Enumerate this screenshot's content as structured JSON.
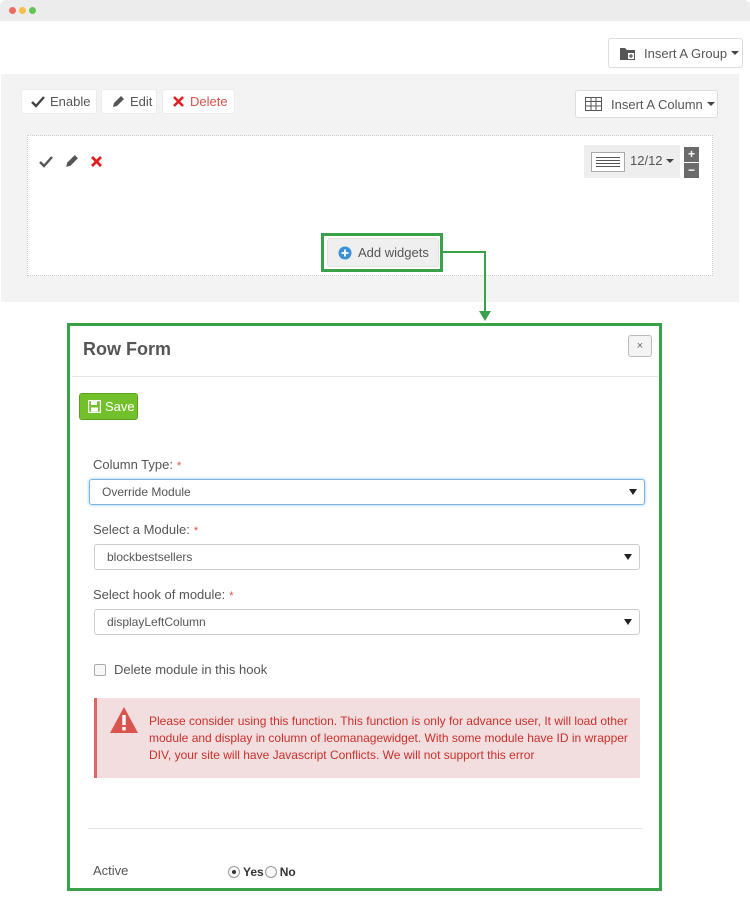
{
  "toolbar_top": {
    "insert_group_label": "Insert A Group"
  },
  "row_toolbar": {
    "enable_label": "Enable",
    "edit_label": "Edit",
    "delete_label": "Delete",
    "insert_column_label": "Insert A Column"
  },
  "column": {
    "width_label": "12/12",
    "plus_label": "+",
    "minus_label": "−",
    "add_widgets_label": "Add widgets"
  },
  "form": {
    "title": "Row Form",
    "close_label": "×",
    "save_label": "Save",
    "column_type": {
      "label": "Column Type:",
      "required": "*",
      "value": "Override Module"
    },
    "module": {
      "label": "Select a Module:",
      "required": "*",
      "value": "blockbestsellers"
    },
    "hook": {
      "label": "Select hook of module:",
      "required": "*",
      "value": "displayLeftColumn"
    },
    "delete_module_label": "Delete module in this hook",
    "warning_text": "Please consider using this function. This function is only for advance user, It will load other module and display in column of leomanagewidget. With some module have ID in wrapper DIV, your site will have Javascript Conflicts. We will not support this error",
    "active": {
      "label": "Active",
      "yes_label": "Yes",
      "no_label": "No",
      "selected": "Yes"
    }
  },
  "colors": {
    "highlight": "#3aa14a",
    "save": "#72c02c",
    "danger": "#d9534f",
    "info": "#3a8fd6",
    "warning_bg": "#f2dede"
  }
}
